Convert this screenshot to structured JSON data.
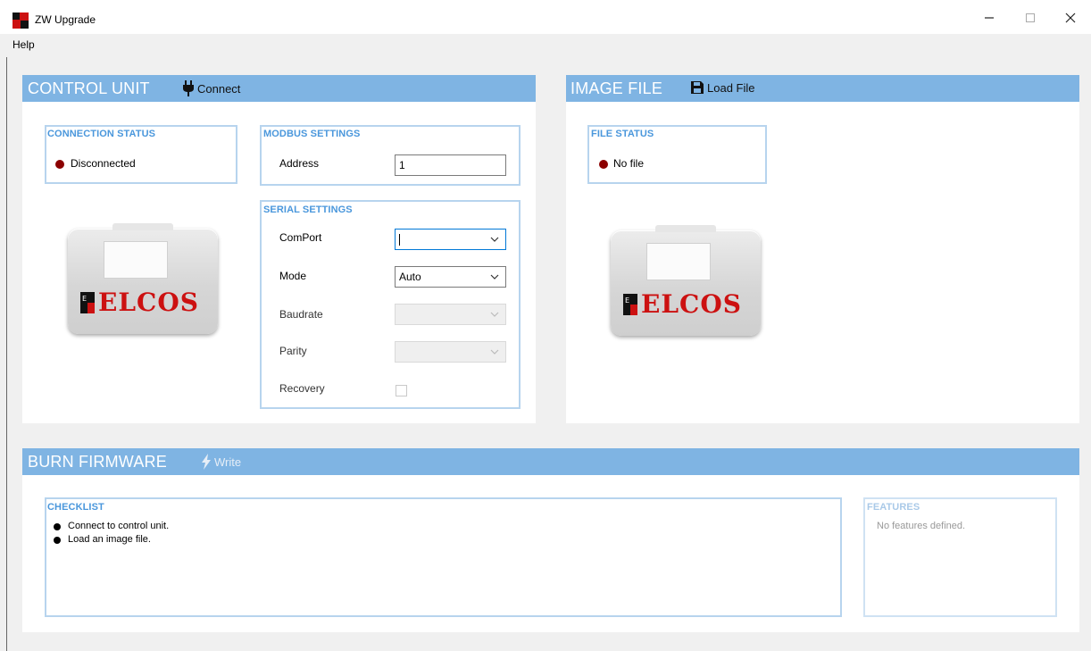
{
  "window": {
    "title": "ZW Upgrade",
    "minimize_icon": "minimize-icon",
    "maximize_icon": "maximize-icon",
    "close_icon": "close-icon"
  },
  "menu": {
    "items": [
      "Help"
    ]
  },
  "control_unit": {
    "title": "CONTROL UNIT",
    "connect_label": "Connect",
    "connect_icon": "plug-icon",
    "connection_status": {
      "title": "CONNECTION STATUS",
      "value": "Disconnected",
      "color": "#8b0000"
    },
    "modbus": {
      "title": "MODBUS SETTINGS",
      "address_label": "Address",
      "address_value": "1"
    },
    "serial": {
      "title": "SERIAL SETTINGS",
      "comport_label": "ComPort",
      "comport_value": "",
      "mode_label": "Mode",
      "mode_value": "Auto",
      "baudrate_label": "Baudrate",
      "baudrate_value": "",
      "parity_label": "Parity",
      "parity_value": "",
      "recovery_label": "Recovery",
      "recovery_checked": false
    },
    "device_brand": "ELCOS"
  },
  "image_file": {
    "title": "IMAGE FILE",
    "load_label": "Load File",
    "load_icon": "floppy-disk-icon",
    "file_status": {
      "title": "FILE STATUS",
      "value": "No file",
      "color": "#8b0000"
    },
    "device_brand": "ELCOS"
  },
  "burn": {
    "title": "BURN FIRMWARE",
    "write_label": "Write",
    "write_icon": "lightning-icon",
    "checklist": {
      "title": "CHECKLIST",
      "items": [
        "Connect to control unit.",
        "Load an image file."
      ]
    },
    "features": {
      "title": "FEATURES",
      "empty_text": "No features defined."
    }
  },
  "colors": {
    "header_blue": "#7fb4e3",
    "group_title_blue": "#4a97dc",
    "status_dot": "#8b0000"
  }
}
